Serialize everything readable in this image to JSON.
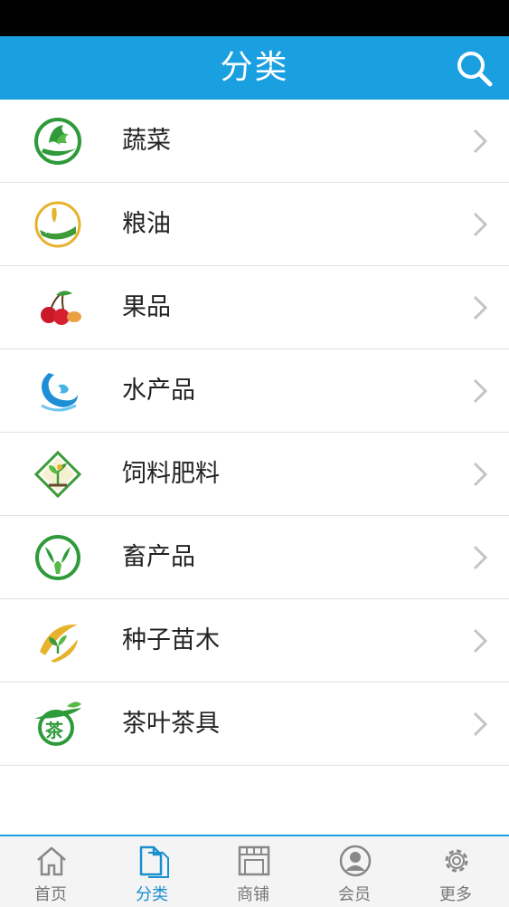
{
  "header": {
    "title": "分类"
  },
  "icons": {
    "search": "search-icon",
    "chevron": "chevron-right-icon"
  },
  "colors": {
    "primary": "#1aa0e0",
    "active_tab": "#1a8fd0"
  },
  "categories": [
    {
      "label": "蔬菜",
      "icon": "vegetables-icon"
    },
    {
      "label": "粮油",
      "icon": "grain-oil-icon"
    },
    {
      "label": "果品",
      "icon": "fruit-icon"
    },
    {
      "label": "水产品",
      "icon": "aquatic-products-icon"
    },
    {
      "label": "饲料肥料",
      "icon": "feed-fertilizer-icon"
    },
    {
      "label": "畜产品",
      "icon": "livestock-products-icon"
    },
    {
      "label": "种子苗木",
      "icon": "seeds-seedlings-icon"
    },
    {
      "label": "茶叶茶具",
      "icon": "tea-icon"
    }
  ],
  "tabbar": {
    "active": "分类",
    "tabs": [
      {
        "label": "首页",
        "icon": "home-icon"
      },
      {
        "label": "分类",
        "icon": "category-icon"
      },
      {
        "label": "商铺",
        "icon": "shop-icon"
      },
      {
        "label": "会员",
        "icon": "member-icon"
      },
      {
        "label": "更多",
        "icon": "gear-icon"
      }
    ]
  }
}
